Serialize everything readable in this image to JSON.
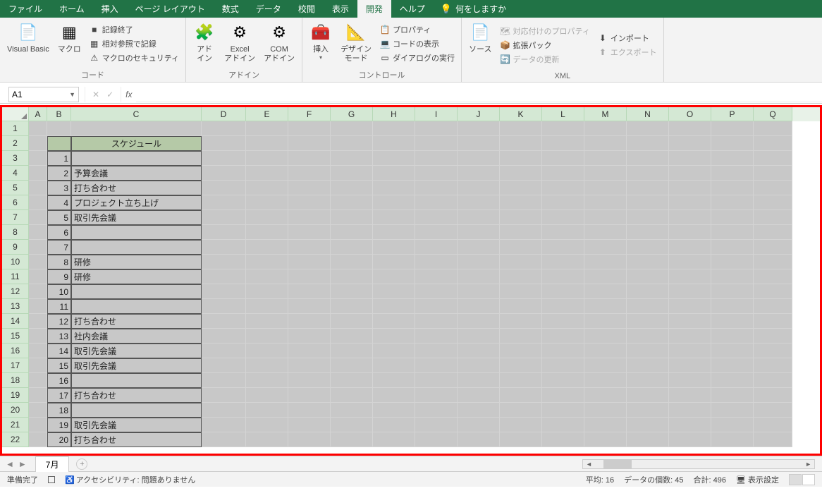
{
  "menu": {
    "tabs": [
      "ファイル",
      "ホーム",
      "挿入",
      "ページ レイアウト",
      "数式",
      "データ",
      "校閲",
      "表示",
      "開発",
      "ヘルプ"
    ],
    "active": "開発",
    "search": "何をしますか"
  },
  "ribbon": {
    "code": {
      "label": "コード",
      "vb": "Visual Basic",
      "macro": "マクロ",
      "recstop": "記録終了",
      "relref": "相対参照で記録",
      "security": "マクロのセキュリティ"
    },
    "addins": {
      "label": "アドイン",
      "addin": "アド\nイン",
      "exceladdin": "Excel\nアドイン",
      "comaddin": "COM\nアドイン"
    },
    "controls": {
      "label": "コントロール",
      "insert": "挿入",
      "design": "デザイン\nモード",
      "prop": "プロパティ",
      "viewcode": "コードの表示",
      "dialog": "ダイアログの実行"
    },
    "xml": {
      "label": "XML",
      "source": "ソース",
      "mapprop": "対応付けのプロパティ",
      "expansion": "拡張パック",
      "refresh": "データの更新",
      "import": "インポート",
      "export": "エクスポート"
    }
  },
  "namebox": "A1",
  "columns": [
    {
      "l": "A",
      "w": 26
    },
    {
      "l": "B",
      "w": 34
    },
    {
      "l": "C",
      "w": 185
    },
    {
      "l": "D",
      "w": 63
    },
    {
      "l": "E",
      "w": 60
    },
    {
      "l": "F",
      "w": 60
    },
    {
      "l": "G",
      "w": 60
    },
    {
      "l": "H",
      "w": 60
    },
    {
      "l": "I",
      "w": 60
    },
    {
      "l": "J",
      "w": 60
    },
    {
      "l": "K",
      "w": 60
    },
    {
      "l": "L",
      "w": 60
    },
    {
      "l": "M",
      "w": 60
    },
    {
      "l": "N",
      "w": 60
    },
    {
      "l": "O",
      "w": 60
    },
    {
      "l": "P",
      "w": 60
    },
    {
      "l": "Q",
      "w": 55
    }
  ],
  "data": {
    "header": "スケジュール",
    "rows": [
      {
        "n": "1",
        "t": ""
      },
      {
        "n": "2",
        "t": "予算会議"
      },
      {
        "n": "3",
        "t": "打ち合わせ"
      },
      {
        "n": "4",
        "t": "プロジェクト立ち上げ"
      },
      {
        "n": "5",
        "t": "取引先会議"
      },
      {
        "n": "6",
        "t": ""
      },
      {
        "n": "7",
        "t": ""
      },
      {
        "n": "8",
        "t": "研修"
      },
      {
        "n": "9",
        "t": "研修"
      },
      {
        "n": "10",
        "t": ""
      },
      {
        "n": "11",
        "t": ""
      },
      {
        "n": "12",
        "t": "打ち合わせ"
      },
      {
        "n": "13",
        "t": "社内会議"
      },
      {
        "n": "14",
        "t": "取引先会議"
      },
      {
        "n": "15",
        "t": "取引先会議"
      },
      {
        "n": "16",
        "t": ""
      },
      {
        "n": "17",
        "t": "打ち合わせ"
      },
      {
        "n": "18",
        "t": ""
      },
      {
        "n": "19",
        "t": "取引先会議"
      },
      {
        "n": "20",
        "t": "打ち合わせ"
      }
    ]
  },
  "sheettab": "7月",
  "status": {
    "ready": "準備完了",
    "acc": "アクセシビリティ: 問題ありません",
    "avg": "平均: 16",
    "count": "データの個数: 45",
    "sum": "合計: 496",
    "display": "表示設定"
  }
}
